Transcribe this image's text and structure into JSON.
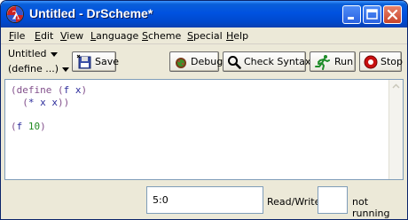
{
  "window": {
    "title": "Untitled - DrScheme*",
    "controls": [
      "minimize",
      "maximize",
      "close"
    ]
  },
  "menu": [
    {
      "label": "File",
      "mnemonic": "F",
      "rest": "ile"
    },
    {
      "label": "Edit",
      "mnemonic": "E",
      "rest": "dit"
    },
    {
      "label": "View",
      "mnemonic": "V",
      "rest": "iew"
    },
    {
      "label": "Language",
      "mnemonic": "L",
      "rest": "anguage"
    },
    {
      "label": "Scheme",
      "mnemonic": "S",
      "rest": "cheme"
    },
    {
      "label": "Special",
      "mnemonic": "S",
      "rest": "pecial"
    },
    {
      "label": "Help",
      "mnemonic": "H",
      "rest": "elp"
    }
  ],
  "toolbar": {
    "file_selector": "Untitled",
    "define_selector": "(define ...)",
    "save_label": "Save",
    "debug_label": "Debug",
    "check_syntax_label": "Check Syntax",
    "run_label": "Run",
    "stop_label": "Stop"
  },
  "editor": {
    "lines": [
      "(define (f x)",
      "  (* x x))",
      "",
      "(f 10)"
    ],
    "tokens": {
      "l0_open": "(",
      "l0_define": "define",
      "l0_sp1": " ",
      "l0_open2": "(",
      "l0_f": "f",
      "l0_sp2": " ",
      "l0_x": "x",
      "l0_close": ")",
      "l1_indent": "  ",
      "l1_open": "(",
      "l1_star": "*",
      "l1_sp1": " ",
      "l1_x1": "x",
      "l1_sp2": " ",
      "l1_x2": "x",
      "l1_close": "))",
      "l3_open": "(",
      "l3_f": "f",
      "l3_sp": " ",
      "l3_num": "10",
      "l3_close": ")"
    },
    "colors": {
      "paren": "#824f8b",
      "keyword": "#824f8b",
      "identifier": "#2c2c9b",
      "constant": "#228b22"
    }
  },
  "status": {
    "position": "5:0",
    "mode": "Read/Write",
    "blank": "",
    "run_state": "not running"
  }
}
